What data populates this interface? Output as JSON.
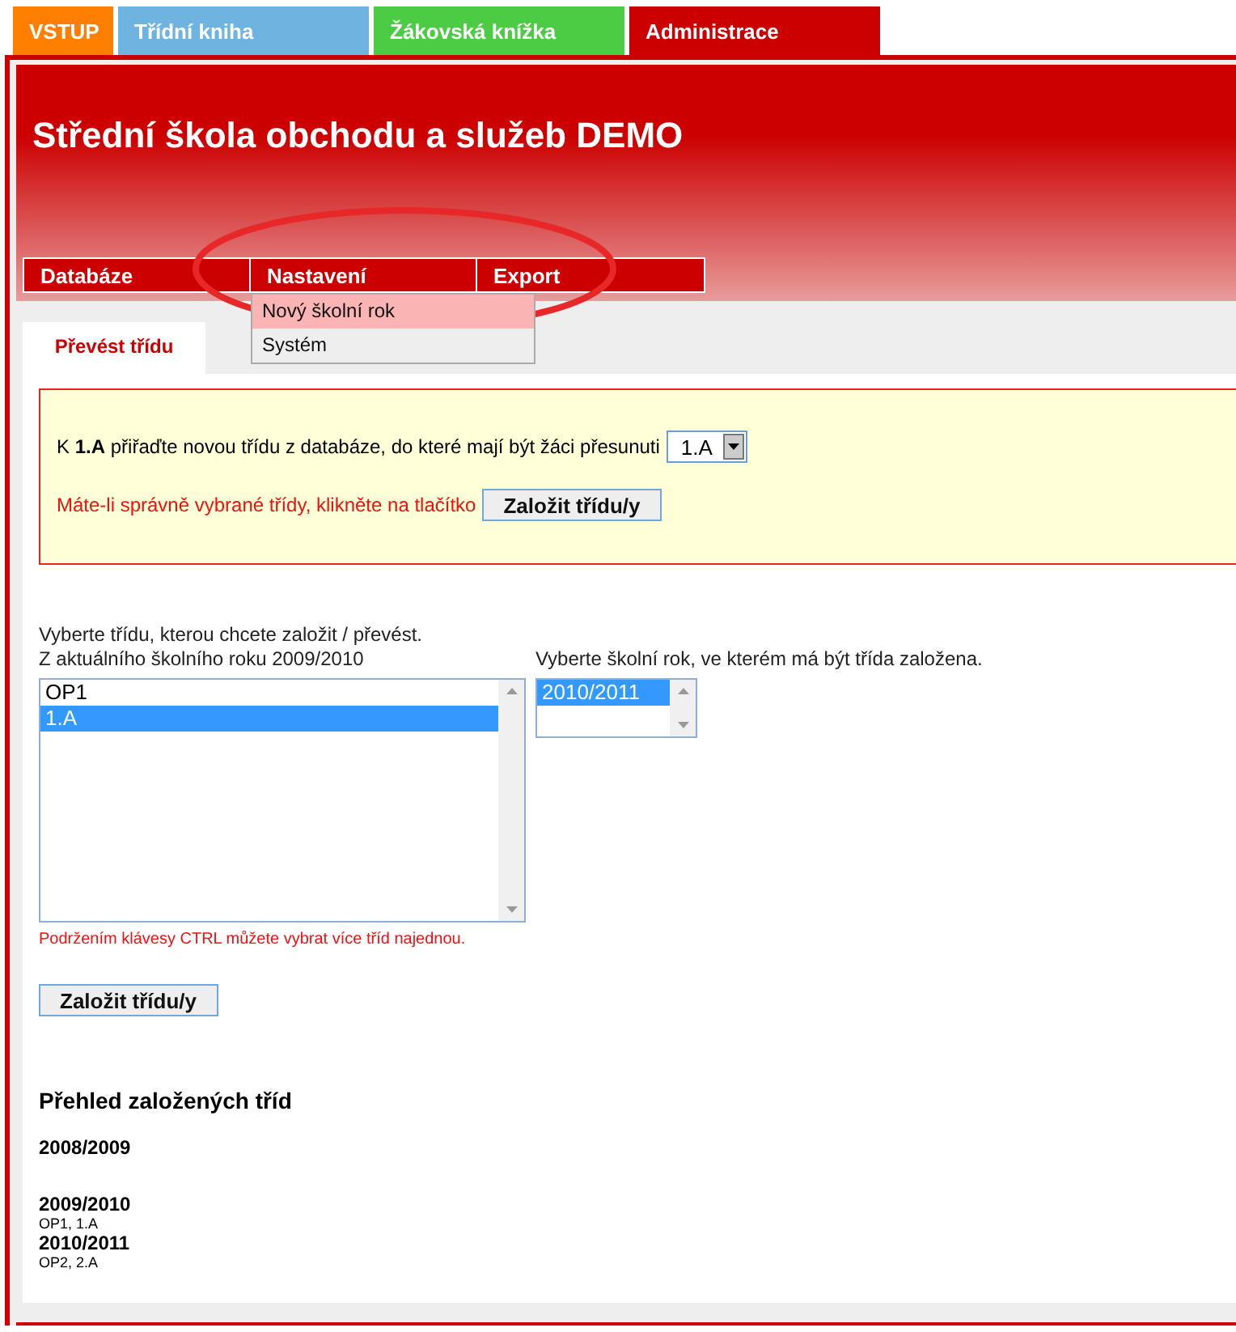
{
  "top_tabs": [
    {
      "label": "VSTUP",
      "color": "#ff8000"
    },
    {
      "label": "Třídní kniha",
      "color": "#6fb4e0"
    },
    {
      "label": "Žákovská knížka",
      "color": "#4ccc44"
    },
    {
      "label": "Administrace",
      "color": "#cc0000"
    }
  ],
  "header": {
    "title": "Střední škola obchodu a služeb DEMO"
  },
  "menu": [
    {
      "label": "Databáze"
    },
    {
      "label": "Nastavení"
    },
    {
      "label": "Export"
    }
  ],
  "dropdown": {
    "items": [
      {
        "label": "Nový školní rok",
        "selected": true
      },
      {
        "label": "Systém",
        "selected": false
      }
    ]
  },
  "sub_tabs": [
    {
      "label": "Převést třídu",
      "selected": true
    }
  ],
  "notice": {
    "text": "K **1.A** přiřaďte novou třídu z databáze, do které mají být žáci přesunuti",
    "select_value": "1.A",
    "hint": "Máte-li správně vybrané třídy, klikněte na tlačítko",
    "button": "Založit třídu/y"
  },
  "class_select": {
    "label1": "Vyberte třídu, kterou chcete založit / převést.",
    "label2": "Z aktuálního školního roku 2009/2010",
    "items": [
      {
        "label": "OP1",
        "selected": false
      },
      {
        "label": "1.A",
        "selected": true
      }
    ],
    "hint": "Podržením klávesy CTRL můžete vybrat více tříd najednou."
  },
  "year_select": {
    "label": "Vyberte školní rok, ve kterém má být třída založena.",
    "items": [
      {
        "label": "2010/2011",
        "selected": true
      }
    ]
  },
  "submit_button": "Založit třídu/y",
  "overview": {
    "title": "Přehled založených tříd",
    "years": [
      {
        "year": "2008/2009"
      },
      {
        "year": "2009/2010",
        "classes": "OP1, 1.A"
      },
      {
        "year": "2010/2011",
        "classes": "OP2, 2.A"
      }
    ]
  }
}
